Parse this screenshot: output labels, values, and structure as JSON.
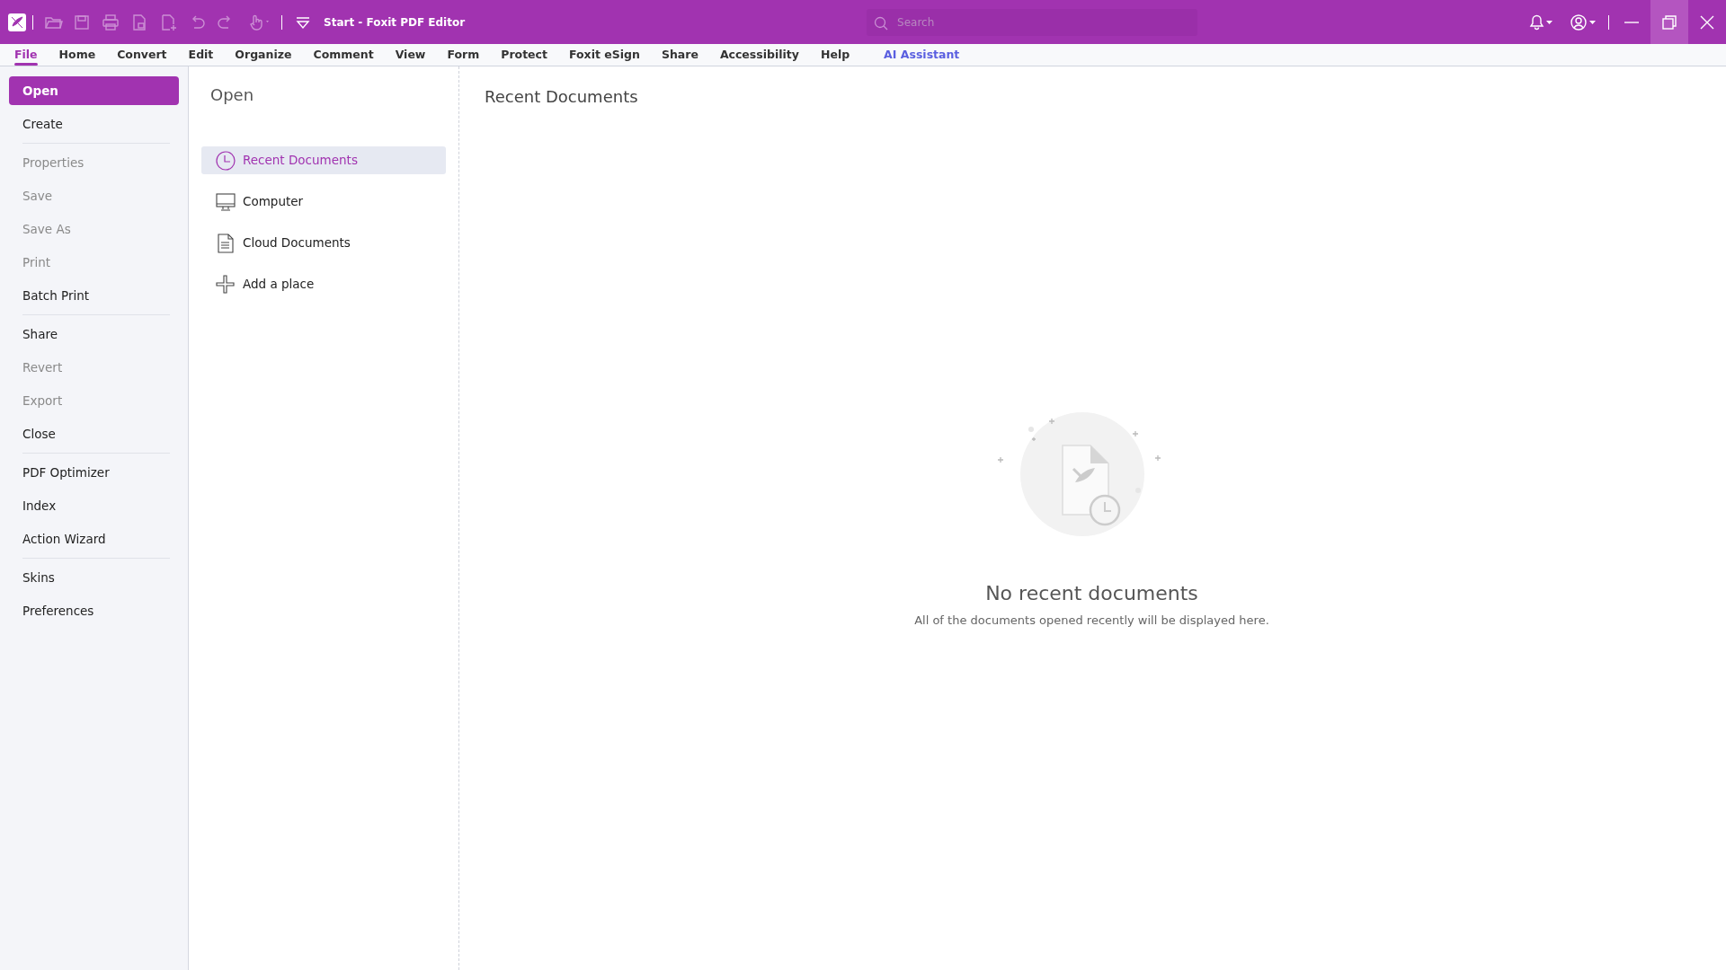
{
  "window": {
    "title": "Start - Foxit PDF Editor"
  },
  "quick_access": [
    {
      "kind": "open",
      "disabled": true
    },
    {
      "kind": "save",
      "disabled": true
    },
    {
      "kind": "print",
      "disabled": true
    },
    {
      "kind": "doc",
      "disabled": true
    },
    {
      "kind": "new",
      "disabled": true
    },
    {
      "kind": "undo",
      "disabled": true
    },
    {
      "kind": "redo",
      "disabled": true
    },
    {
      "kind": "hand",
      "disabled": true
    },
    {
      "kind": "customize",
      "disabled": false
    }
  ],
  "search": {
    "placeholder": "Search"
  },
  "tabs": [
    {
      "label": "File",
      "selected": true,
      "kind": "plain"
    },
    {
      "label": "Home",
      "selected": false,
      "kind": "plain"
    },
    {
      "label": "Convert",
      "selected": false,
      "kind": "plain"
    },
    {
      "label": "Edit",
      "selected": false,
      "kind": "plain"
    },
    {
      "label": "Organize",
      "selected": false,
      "kind": "plain"
    },
    {
      "label": "Comment",
      "selected": false,
      "kind": "plain"
    },
    {
      "label": "View",
      "selected": false,
      "kind": "plain"
    },
    {
      "label": "Form",
      "selected": false,
      "kind": "plain"
    },
    {
      "label": "Protect",
      "selected": false,
      "kind": "plain"
    },
    {
      "label": "Foxit eSign",
      "selected": false,
      "kind": "plain"
    },
    {
      "label": "Share",
      "selected": false,
      "kind": "plain"
    },
    {
      "label": "Accessibility",
      "selected": false,
      "kind": "plain"
    },
    {
      "label": "Help",
      "selected": false,
      "kind": "plain"
    },
    {
      "label": "AI Assistant",
      "selected": false,
      "kind": "ai"
    }
  ],
  "sidebar": {
    "groups": [
      [
        {
          "label": "Open",
          "selected": true,
          "disabled": false
        },
        {
          "label": "Create",
          "selected": false,
          "disabled": false
        }
      ],
      [
        {
          "label": "Properties",
          "selected": false,
          "disabled": true
        },
        {
          "label": "Save",
          "selected": false,
          "disabled": true
        },
        {
          "label": "Save As",
          "selected": false,
          "disabled": true
        },
        {
          "label": "Print",
          "selected": false,
          "disabled": true
        },
        {
          "label": "Batch Print",
          "selected": false,
          "disabled": false
        }
      ],
      [
        {
          "label": "Share",
          "selected": false,
          "disabled": false
        },
        {
          "label": "Revert",
          "selected": false,
          "disabled": true
        },
        {
          "label": "Export",
          "selected": false,
          "disabled": true
        },
        {
          "label": "Close",
          "selected": false,
          "disabled": false
        }
      ],
      [
        {
          "label": "PDF Optimizer",
          "selected": false,
          "disabled": false
        },
        {
          "label": "Index",
          "selected": false,
          "disabled": false
        },
        {
          "label": "Action Wizard",
          "selected": false,
          "disabled": false
        }
      ],
      [
        {
          "label": "Skins",
          "selected": false,
          "disabled": false
        },
        {
          "label": "Preferences",
          "selected": false,
          "disabled": false
        }
      ]
    ]
  },
  "open_panel": {
    "title": "Open",
    "places": [
      {
        "label": "Recent Documents",
        "kind": "recent",
        "selected": true
      },
      {
        "label": "Computer",
        "kind": "computer",
        "selected": false
      },
      {
        "label": "Cloud Documents",
        "kind": "cloud",
        "selected": false
      },
      {
        "label": "Add a place",
        "kind": "add",
        "selected": false
      }
    ]
  },
  "content": {
    "title": "Recent Documents",
    "empty_title": "No recent documents",
    "empty_message": "All of the documents opened recently will be displayed here."
  }
}
